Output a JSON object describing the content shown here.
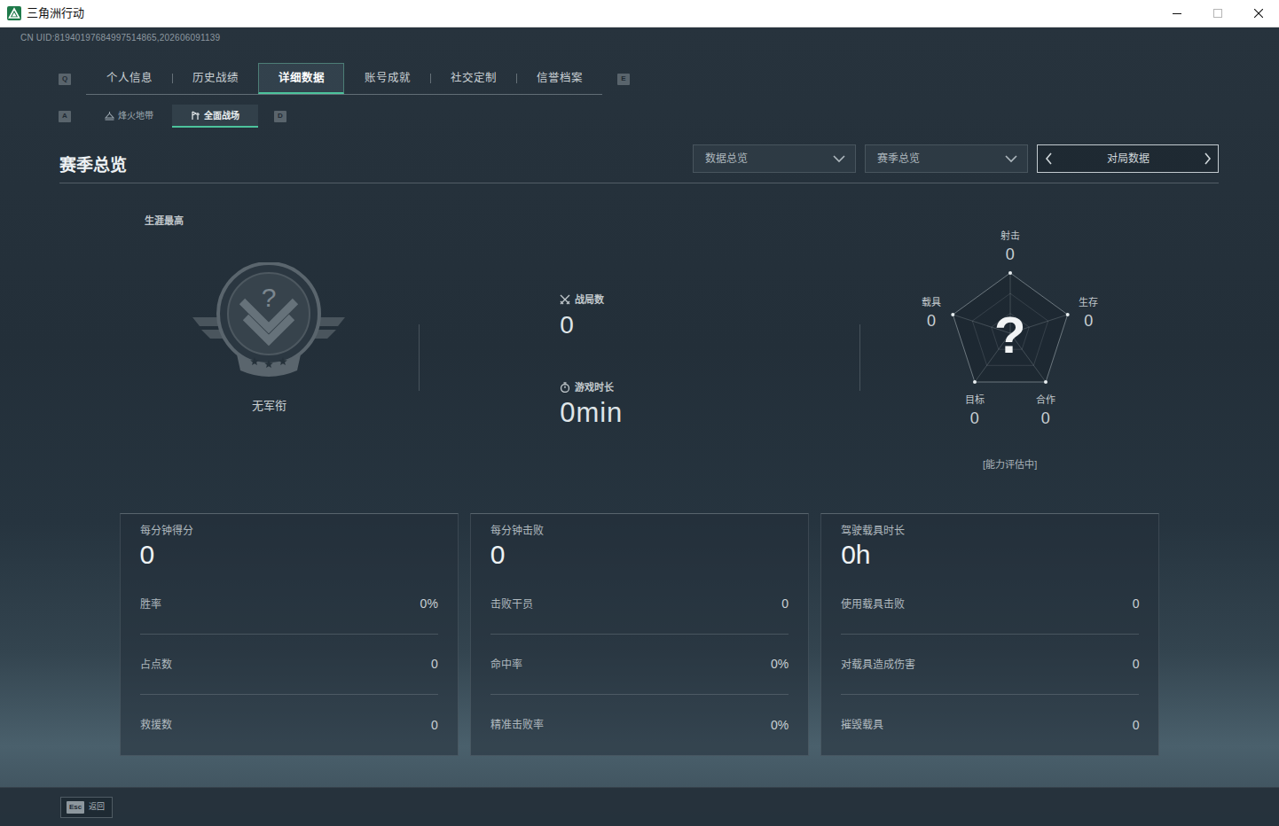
{
  "window": {
    "title": "三角洲行动"
  },
  "uid": "CN UID:81940197684997514865,202606091139",
  "tab_keys": {
    "prev": "Q",
    "next": "E"
  },
  "tabs": [
    {
      "label": "个人信息",
      "selected": false
    },
    {
      "label": "历史战绩",
      "selected": false
    },
    {
      "label": "详细数据",
      "selected": true
    },
    {
      "label": "账号成就",
      "selected": false
    },
    {
      "label": "社交定制",
      "selected": false
    },
    {
      "label": "信誉档案",
      "selected": false
    }
  ],
  "subtab_keys": {
    "prev": "A",
    "next": "D"
  },
  "subtabs": [
    {
      "label": "烽火地带",
      "selected": false
    },
    {
      "label": "全面战场",
      "selected": true
    }
  ],
  "section": {
    "title": "赛季总览",
    "filters": [
      {
        "label": "数据总览"
      },
      {
        "label": "赛季总览"
      }
    ],
    "pager": {
      "label": "对局数据"
    }
  },
  "career": {
    "caption": "生涯最高",
    "emblem_mark": "?",
    "rank": "无军衔"
  },
  "summary": [
    {
      "label": "战局数",
      "value": "0"
    },
    {
      "label": "游戏时长",
      "value": "0min"
    }
  ],
  "radar": {
    "axes": [
      {
        "label": "射击",
        "value": "0"
      },
      {
        "label": "生存",
        "value": "0"
      },
      {
        "label": "合作",
        "value": "0"
      },
      {
        "label": "目标",
        "value": "0"
      },
      {
        "label": "载具",
        "value": "0"
      }
    ],
    "center": "?",
    "status": "[能力评估中]"
  },
  "cards": [
    {
      "title": "每分钟得分",
      "value": "0",
      "rows": [
        {
          "label": "胜率",
          "value": "0%"
        },
        {
          "label": "占点数",
          "value": "0"
        },
        {
          "label": "救援数",
          "value": "0"
        }
      ]
    },
    {
      "title": "每分钟击败",
      "value": "0",
      "rows": [
        {
          "label": "击败干员",
          "value": "0"
        },
        {
          "label": "命中率",
          "value": "0%"
        },
        {
          "label": "精准击败率",
          "value": "0%"
        }
      ]
    },
    {
      "title": "驾驶载具时长",
      "value": "0h",
      "rows": [
        {
          "label": "使用载具击败",
          "value": "0"
        },
        {
          "label": "对载具造成伤害",
          "value": "0"
        },
        {
          "label": "摧毁载具",
          "value": "0"
        }
      ]
    }
  ],
  "footer": {
    "key": "Esc",
    "label": "返回"
  }
}
